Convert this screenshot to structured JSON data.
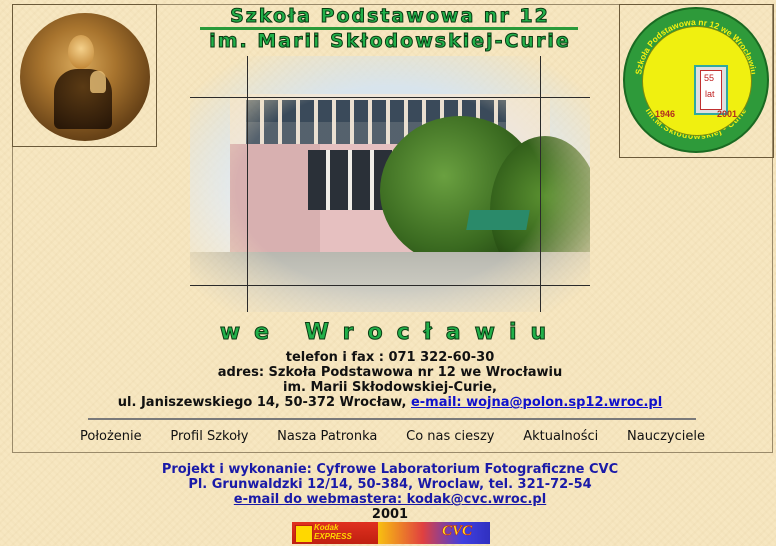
{
  "header": {
    "title_line1": "Szkoła Podstawowa nr 12",
    "title_line2": "im. Marii Skłodowskiej-Curie",
    "city": "we Wrocławiu"
  },
  "logo": {
    "ring_text_top": "Szkoła Podstawowa nr 12 we Wrocławiu",
    "ring_text_bottom": "im.M.Skłodowskiej - Curie",
    "years_number": "55",
    "years_label": "lat",
    "year_start": "1946",
    "year_end": "2001"
  },
  "contact": {
    "phone": "telefon i fax : 071 322-60-30",
    "address_line1": "adres: Szkoła Podstawowa nr 12 we Wrocławiu",
    "address_line2": "im. Marii Skłodowskiej-Curie,",
    "address_street": "ul. Janiszewskiego 14, 50-372 Wrocław,",
    "email_link": "e-mail: wojna@polon.sp12.wroc.pl"
  },
  "nav": {
    "items": [
      "Położenie",
      "Profil Szkoły",
      "Nasza Patronka",
      "Co nas cieszy",
      "Aktualności",
      "Nauczyciele"
    ]
  },
  "credits": {
    "line1": "Projekt i wykonanie: Cyfrowe Laboratorium Fotograficzne CVC",
    "line2": "Pl. Grunwaldzki 12/14, 50-384, Wroclaw, tel. 321-72-54",
    "webmaster_link": "e-mail do webmastera: kodak@cvc.wroc.pl",
    "year": "2001"
  },
  "banner": {
    "kodak_line1": "Kodak",
    "kodak_line2": "EXPRESS",
    "cvc": "CVC"
  },
  "colors": {
    "background": "#f7e7c1",
    "title_green": "#22b04a",
    "link_blue": "#1010cc",
    "credits_blue": "#1a1aa8"
  }
}
